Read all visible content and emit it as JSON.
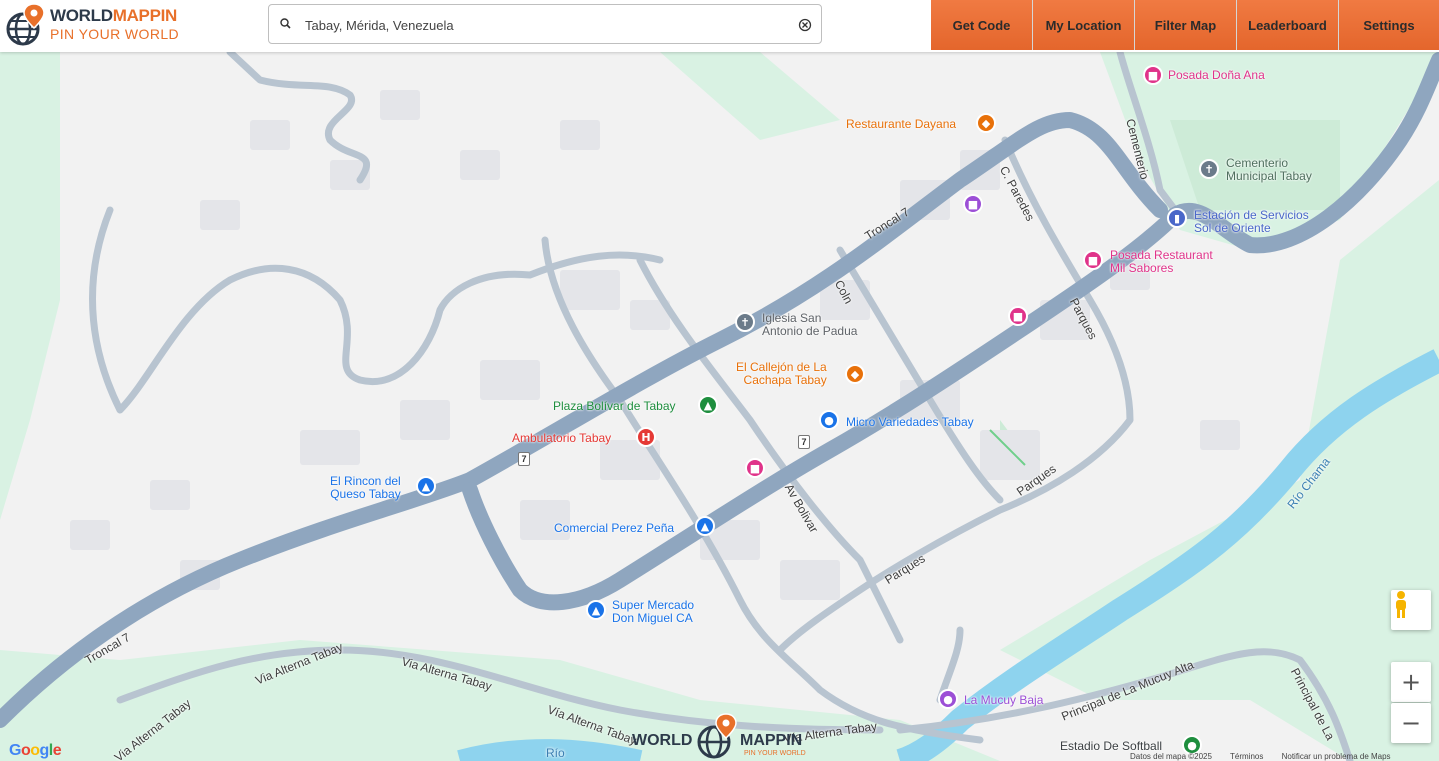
{
  "header": {
    "logo": {
      "line1_dark": "WORLD",
      "line1_orange": "MAPPIN",
      "line2": "PIN YOUR WORLD"
    },
    "search": {
      "value": "Tabay, Mérida, Venezuela",
      "placeholder": ""
    },
    "nav": [
      "Get Code",
      "My Location",
      "Filter Map",
      "Leaderboard",
      "Settings"
    ],
    "colors": {
      "nav_bg": "#e8702a",
      "brand_dark": "#2d3a4a"
    }
  },
  "map": {
    "places": [
      {
        "name": "Posada Doña Ana",
        "icon": "hotel-icon",
        "color": "#e0338a"
      },
      {
        "name": "Restaurante Dayana",
        "icon": "restaurant-icon",
        "color": "#e8710a"
      },
      {
        "name_l1": "Cementerio",
        "name_l2": "Municipal Tabay",
        "icon": "cemetery-icon",
        "color": "#6b7b8a"
      },
      {
        "name_l1": "Estación de Servicios",
        "name_l2": "Sol de Oriente",
        "icon": "gas-station-icon",
        "color": "#4a67c9"
      },
      {
        "name_l1": "Posada Restaurant",
        "name_l2": "Mil Sabores",
        "icon": "hotel-icon",
        "color": "#e0338a"
      },
      {
        "name_l1": "Iglesia San",
        "name_l2": "Antonio de Padua",
        "icon": "church-icon",
        "color": "#6b7b8a"
      },
      {
        "name_l1": "El Callejón de La",
        "name_l2": "Cachapa Tabay",
        "icon": "restaurant-icon",
        "color": "#e8710a"
      },
      {
        "name": "Plaza Bolívar de Tabay",
        "icon": "park-icon",
        "color": "#1e8e3e"
      },
      {
        "name": "Micro Variedades Tabay",
        "icon": "shopping-icon",
        "color": "#1a73e8"
      },
      {
        "name": "Ambulatorio Tabay",
        "icon": "hospital-icon",
        "color": "#e53935"
      },
      {
        "name_l1": "El Rincon del",
        "name_l2": "Queso Tabay",
        "icon": "shopping-cart-icon",
        "color": "#1a73e8"
      },
      {
        "name": "Comercial Perez Peña",
        "icon": "shopping-cart-icon",
        "color": "#1a73e8"
      },
      {
        "name_l1": "Super Mercado",
        "name_l2": "Don Miguel CA",
        "icon": "shopping-cart-icon",
        "color": "#1a73e8"
      },
      {
        "name": "La Mucuy Baja",
        "icon": "camera-icon",
        "color": "#9c4fd6"
      },
      {
        "name": "Estadio De Softball",
        "icon": "stadium-icon",
        "color": "#1e8e3e"
      }
    ],
    "roads": {
      "troncal_upper": "Troncal 7",
      "troncal_lower": "Troncal 7",
      "cementerio": "Cementerio",
      "c_paredes": "C. Paredes",
      "coln": "Coln",
      "parques_upper": "Parques",
      "parques_mid": "Parques",
      "parques_lower": "Parques",
      "av_bolivar": "Av Bolivar",
      "via_alterna_1": "Via Alterna Tabay",
      "via_alterna_2": "Via Alterna Tabay",
      "via_alterna_3": "Via Alterna Tabay",
      "via_alterna_4": "Vía Alterna Tabay",
      "via_alterna_5": "Vía Alterna Tabay",
      "principal_mucuy": "Principal de La Mucuy Alta",
      "principal_right": "Principal de La",
      "rio_chama": "Río Chama",
      "rio_bottom": "Río"
    },
    "route_shield": "7",
    "controls": {
      "zoom_in": "+",
      "zoom_out": "−"
    },
    "attribution": {
      "google": "Google",
      "data": "Datos del mapa ©2025",
      "terms": "Términos",
      "report": "Notificar un problema de Maps"
    },
    "watermark": {
      "left": "WORLD",
      "right": "MAPPIN",
      "tag": "PIN YOUR WORLD"
    }
  }
}
